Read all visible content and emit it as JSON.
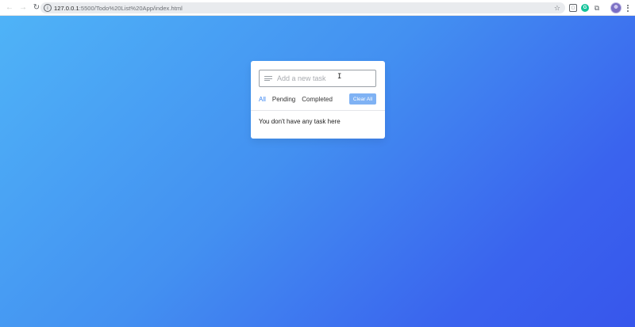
{
  "browser": {
    "url_host": "127.0.0.1",
    "url_rest": ":5500/Todo%20List%20App/index.html",
    "icons": {
      "back": "arrow-left-icon",
      "forward": "arrow-right-icon",
      "reload": "reload-icon",
      "site_info": "info-icon",
      "bookmark": "star-icon",
      "extensions": [
        "cover-icon",
        "grammarly-icon",
        "puzzle-icon"
      ],
      "profile": "avatar",
      "menu": "kebab-menu-icon"
    }
  },
  "todo": {
    "input_placeholder": "Add a new task",
    "filters": [
      "All",
      "Pending",
      "Completed"
    ],
    "active_filter": "All",
    "clear_label": "Clear All",
    "empty_message": "You don't have any task here"
  },
  "colors": {
    "gradient_start": "#4fb3f7",
    "gradient_end": "#3756ec",
    "accent": "#3c87f2",
    "clear_button": "#7fb2f4"
  }
}
